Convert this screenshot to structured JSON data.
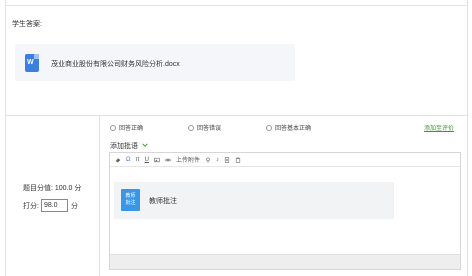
{
  "answer_section": {
    "label": "学生答案:",
    "attachment": {
      "filename": "茂业商业股份有限公司财务风险分析.docx",
      "icon": "word-doc-icon",
      "icon_letter": "W"
    }
  },
  "grading": {
    "total_score_text": "题目分值: 100.0 分",
    "score_label": "打分:",
    "score_value": "98.0",
    "score_unit": "分"
  },
  "answer_options": [
    {
      "label": "回答正确"
    },
    {
      "label": "回答错误"
    },
    {
      "label": "回答基本正确"
    }
  ],
  "right_link": "添加至评价",
  "add_comment_label": "添加批语",
  "toolbar": {
    "upload_attachment": "上传附件"
  },
  "comment": {
    "badge_line1": "教师",
    "badge_line2": "批注",
    "text": "教师批注"
  },
  "colors": {
    "accent_blue": "#3b7fe0",
    "badge_blue": "#3a96e6",
    "link_green": "#4a8f3f"
  }
}
